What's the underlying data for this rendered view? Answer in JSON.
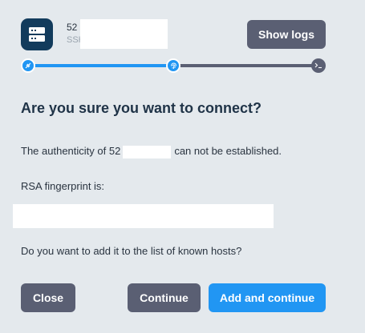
{
  "host": {
    "name": "52",
    "subtitle": "SSH",
    "icon": "server-icon"
  },
  "header": {
    "show_logs_label": "Show logs"
  },
  "progress": {
    "steps": [
      "connect-icon",
      "fingerprint-icon",
      "terminal-icon"
    ],
    "current_step": 2,
    "active_color": "#2196f3",
    "inactive_color": "#5a5f73"
  },
  "dialog": {
    "title": "Are you sure you want to connect?",
    "authenticity_prefix": "The authenticity of 52",
    "authenticity_suffix": "can not be established.",
    "fingerprint_label": "RSA fingerprint is:",
    "known_hosts_question": "Do you want to add it to the list of known hosts?"
  },
  "actions": {
    "close_label": "Close",
    "continue_label": "Continue",
    "add_continue_label": "Add and continue"
  }
}
